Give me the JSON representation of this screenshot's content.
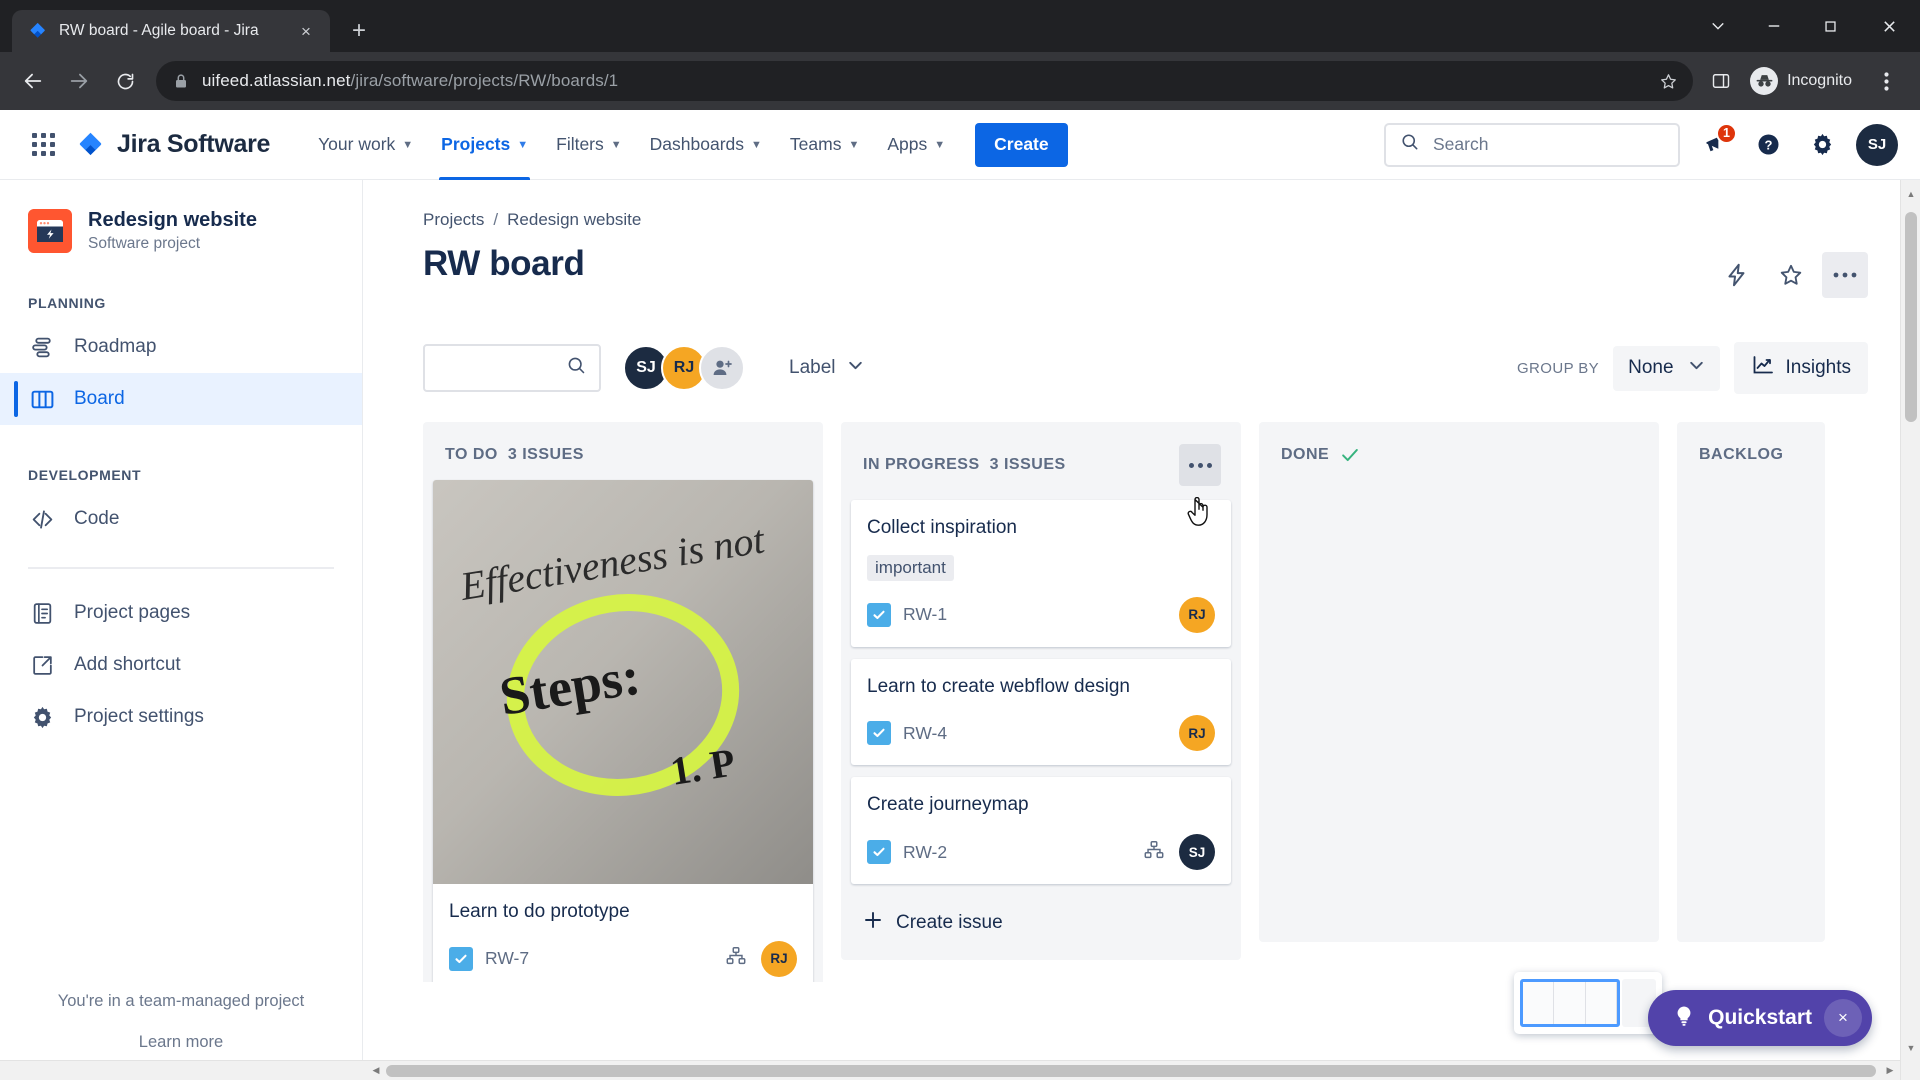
{
  "browser": {
    "tab": {
      "title": "RW board - Agile board - Jira",
      "favicon": "jira-favicon",
      "close": "×"
    },
    "new_tab": "+",
    "window_controls": {
      "minimize_all": "chevron-down",
      "minimize": "minimize",
      "maximize": "maximize",
      "close": "close"
    },
    "url_domain": "uifeed.atlassian.net",
    "url_path": "/jira/software/projects/RW/boards/1",
    "profile_label": "Incognito",
    "lock_icon": "lock-icon",
    "bookmark_icon": "star-icon",
    "sidepanel_icon": "side-panel-icon",
    "menu_icon": "three-dot-menu-icon",
    "back_icon": "back-arrow-icon",
    "forward_icon": "forward-arrow-icon",
    "reload_icon": "reload-icon"
  },
  "topnav": {
    "app_switcher": "app-switcher-icon",
    "brand": "Jira Software",
    "items": [
      {
        "label": "Your work",
        "has_caret": true,
        "active": false
      },
      {
        "label": "Projects",
        "has_caret": true,
        "active": true
      },
      {
        "label": "Filters",
        "has_caret": true,
        "active": false
      },
      {
        "label": "Dashboards",
        "has_caret": true,
        "active": false
      },
      {
        "label": "Teams",
        "has_caret": true,
        "active": false
      },
      {
        "label": "Apps",
        "has_caret": true,
        "active": false
      }
    ],
    "create_label": "Create",
    "search_placeholder": "Search",
    "notifications_badge": "1",
    "help_icon": "question-circle-icon",
    "settings_icon": "gear-icon",
    "profile_initials": "SJ"
  },
  "sidebar": {
    "project_name": "Redesign website",
    "project_type": "Software project",
    "sections": [
      {
        "title": "PLANNING",
        "items": [
          {
            "label": "Roadmap",
            "icon": "roadmap-icon",
            "active": false
          },
          {
            "label": "Board",
            "icon": "board-icon",
            "active": true
          }
        ]
      },
      {
        "title": "DEVELOPMENT",
        "items": [
          {
            "label": "Code",
            "icon": "code-icon",
            "active": false
          }
        ]
      }
    ],
    "extra_items": [
      {
        "label": "Project pages",
        "icon": "pages-icon"
      },
      {
        "label": "Add shortcut",
        "icon": "add-shortcut-icon"
      },
      {
        "label": "Project settings",
        "icon": "settings-gear-icon"
      }
    ],
    "footer_note": "You're in a team-managed project",
    "footer_link": "Learn more"
  },
  "main": {
    "breadcrumb": [
      "Projects",
      "Redesign website"
    ],
    "breadcrumb_separator": "/",
    "page_title": "RW board",
    "title_actions": [
      {
        "name": "automation-icon",
        "hovered": false
      },
      {
        "name": "star-icon",
        "hovered": false
      },
      {
        "name": "more-actions-icon",
        "hovered": true
      }
    ]
  },
  "board_toolbar": {
    "search_value": "",
    "search_placeholder": "",
    "search_icon": "search-icon",
    "avatars": [
      {
        "initials": "SJ",
        "color": "#1c2b41"
      },
      {
        "initials": "RJ",
        "color": "#f5a623"
      }
    ],
    "add_person_icon": "add-person-icon",
    "label_filter": "Label",
    "group_by_label": "GROUP BY",
    "group_by_value": "None",
    "insights_label": "Insights",
    "insights_icon": "insights-chart-icon"
  },
  "board": {
    "columns": [
      {
        "title": "TO DO",
        "count_text": "3 ISSUES",
        "has_more": false,
        "done_check": false,
        "cards": [
          {
            "title": "Learn to do prototype",
            "key": "RW-7",
            "labels": [],
            "has_image": true,
            "image_caption": "Effectiveness is not Steps: 1. P",
            "has_subtask_icon": true,
            "assignee": {
              "initials": "RJ",
              "color": "#f5a623"
            }
          }
        ],
        "create_issue": null
      },
      {
        "title": "IN PROGRESS",
        "count_text": "3 ISSUES",
        "has_more": true,
        "done_check": false,
        "cards": [
          {
            "title": "Collect inspiration",
            "key": "RW-1",
            "labels": [
              "important"
            ],
            "has_image": false,
            "has_subtask_icon": false,
            "assignee": {
              "initials": "RJ",
              "color": "#f5a623"
            }
          },
          {
            "title": "Learn to create webflow design",
            "key": "RW-4",
            "labels": [],
            "has_image": false,
            "has_subtask_icon": false,
            "assignee": {
              "initials": "RJ",
              "color": "#f5a623"
            }
          },
          {
            "title": "Create journeymap",
            "key": "RW-2",
            "labels": [],
            "has_image": false,
            "has_subtask_icon": true,
            "assignee": {
              "initials": "SJ",
              "color": "#1c2b41"
            }
          }
        ],
        "create_issue": "Create issue"
      },
      {
        "title": "DONE",
        "count_text": "",
        "has_more": false,
        "done_check": true,
        "cards": [],
        "create_issue": null
      },
      {
        "title": "BACKLOG",
        "count_text": "",
        "has_more": false,
        "done_check": false,
        "cards": [],
        "create_issue": null
      }
    ]
  },
  "floating": {
    "minimap_name": "board-minimap",
    "quickstart_label": "Quickstart",
    "quickstart_icon": "lightbulb-icon",
    "quickstart_close": "×"
  },
  "colors": {
    "brand_blue": "#0c66e4",
    "purple": "#5243aa",
    "orange": "#f5a623",
    "navy": "#1c2b41",
    "green": "#36b37e",
    "red_badge": "#de350b"
  }
}
